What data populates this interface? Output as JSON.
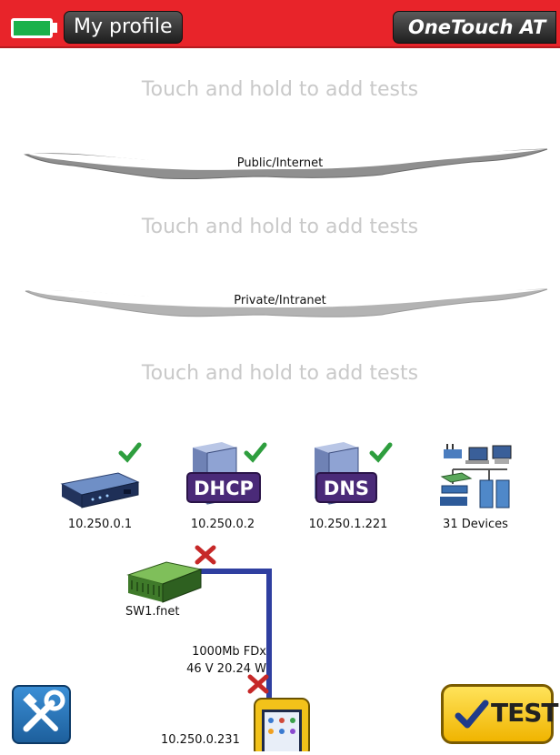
{
  "header": {
    "profile_label": "My profile",
    "brand": "OneTouch AT",
    "battery_icon": "battery-full-icon",
    "colors": {
      "bar": "#e8242a",
      "battery": "#1bb14a"
    }
  },
  "hints": [
    "Touch and hold to add tests",
    "Touch and hold to add tests",
    "Touch and hold to add tests"
  ],
  "clouds": {
    "public": "Public/Internet",
    "private": "Private/Intranet"
  },
  "devices": [
    {
      "label": "10.250.0.1",
      "icon": "router-icon",
      "status": "ok"
    },
    {
      "label": "10.250.0.2",
      "icon": "dhcp-server-icon",
      "badge": "DHCP",
      "status": "ok"
    },
    {
      "label": "10.250.1.221",
      "icon": "dns-server-icon",
      "badge": "DNS",
      "status": "ok"
    },
    {
      "label": "31 Devices",
      "icon": "network-devices-icon"
    }
  ],
  "switch": {
    "label": "SW1.fnet",
    "icon": "switch-icon",
    "status": "fail"
  },
  "link": {
    "speed": "1000Mb FDx",
    "poe": "46 V 20.24 W",
    "status": "fail"
  },
  "tester": {
    "ip": "10.250.0.231",
    "icon": "onetouch-tester-icon"
  },
  "buttons": {
    "tools_icon": "tools-icon",
    "test_label": "TEST",
    "test_icon": "checkmark-icon"
  }
}
